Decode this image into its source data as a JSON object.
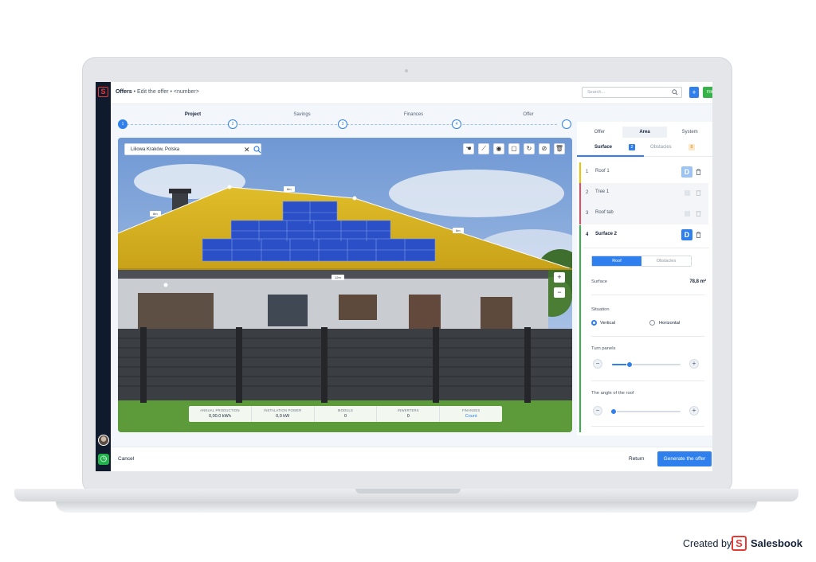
{
  "breadcrumb": {
    "root": "Offers",
    "sep1": "•",
    "edit": "Edit the offer",
    "sep2": "•",
    "number": "<number>"
  },
  "search": {
    "placeholder": "Search..."
  },
  "header": {
    "add_label": "+",
    "filters_label": "Filters ⌄"
  },
  "stepper": {
    "steps": [
      {
        "label": "Project",
        "number": "1"
      },
      {
        "label": "Savings",
        "number": "2"
      },
      {
        "label": "Finances",
        "number": "3"
      },
      {
        "label": "Offer",
        "number": "4"
      }
    ]
  },
  "map": {
    "address": "Liliowa Kraków, Polska",
    "dimensions": [
      "6m",
      "8m",
      "6m",
      "12m"
    ],
    "zoom_in": "+",
    "zoom_out": "−"
  },
  "stats": [
    {
      "label": "ANNUAL PRODUCTION",
      "value": "0,00.0 kWh"
    },
    {
      "label": "INSTALATION POWER",
      "value": "0,0 kW"
    },
    {
      "label": "MODULS",
      "value": "0"
    },
    {
      "label": "INWERTERS",
      "value": "0"
    },
    {
      "label": "FINANSES",
      "value": "Count"
    }
  ],
  "panel": {
    "tabs": [
      "Offer",
      "Area",
      "System"
    ],
    "subtabs": {
      "surface": "Surface",
      "surface_count": "2",
      "obstacles": "Obstacles",
      "obstacles_count": "0"
    },
    "layers": [
      {
        "num": "1",
        "name": "Roof 1",
        "color": "#f2c200"
      },
      {
        "num": "2",
        "name": "Tree 1",
        "color": "#e84a5f"
      },
      {
        "num": "3",
        "name": "Roof tab",
        "color": "#e84a5f"
      },
      {
        "num": "4",
        "name": "Surface 2",
        "color": "#35b248"
      }
    ],
    "d_label": "D",
    "segment": {
      "roof": "Roof",
      "obstacles": "Obstacles"
    },
    "surface_label": "Surface",
    "surface_value": "78,8 m²",
    "situation_label": "Situation",
    "vertical_label": "Vertical",
    "horizontal_label": "Horizontal",
    "turn_panels_label": "Turn panels",
    "turn_panels_level": 0.25,
    "roof_angle_label": "The angle of the roof",
    "roof_angle_level": 0.02
  },
  "footer": {
    "cancel": "Cancel",
    "return": "Return",
    "generate": "Generate the offer"
  },
  "branding": {
    "created_by": "Created by",
    "name": "Salesbook",
    "logo_letter": "S"
  },
  "colors": {
    "accent": "#2f80ed",
    "green": "#35b248",
    "roof": "#d9b21b",
    "panel": "#2a4fc9"
  }
}
